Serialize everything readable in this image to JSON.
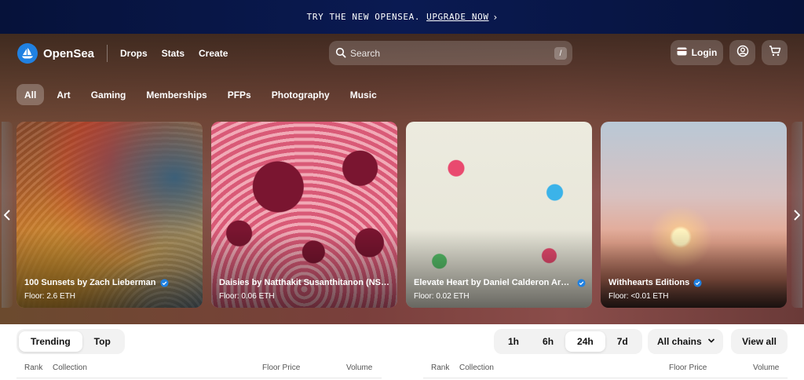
{
  "promo": {
    "text": "TRY THE NEW OPENSEA.",
    "link": "UPGRADE NOW"
  },
  "nav": {
    "brand": "OpenSea",
    "links": [
      "Drops",
      "Stats",
      "Create"
    ],
    "search_placeholder": "Search",
    "search_shortcut": "/",
    "login_label": "Login"
  },
  "categories": [
    {
      "label": "All",
      "active": true
    },
    {
      "label": "Art",
      "active": false
    },
    {
      "label": "Gaming",
      "active": false
    },
    {
      "label": "Memberships",
      "active": false
    },
    {
      "label": "PFPs",
      "active": false
    },
    {
      "label": "Photography",
      "active": false
    },
    {
      "label": "Music",
      "active": false
    }
  ],
  "cards": [
    {
      "name": "100 Sunsets by Zach Lieberman",
      "floor": "Floor: 2.6 ETH"
    },
    {
      "name": "Daisies by Natthakit Susanthitanon (NSmall)",
      "floor": "Floor: 0.06 ETH"
    },
    {
      "name": "Elevate Heart by Daniel Calderon Arenas",
      "floor": "Floor: 0.02 ETH"
    },
    {
      "name": "Withhearts Editions",
      "floor": "Floor: <0.01 ETH"
    }
  ],
  "list_tabs": [
    {
      "label": "Trending",
      "active": true
    },
    {
      "label": "Top",
      "active": false
    }
  ],
  "time_ranges": [
    {
      "label": "1h",
      "active": false
    },
    {
      "label": "6h",
      "active": false
    },
    {
      "label": "24h",
      "active": true
    },
    {
      "label": "7d",
      "active": false
    }
  ],
  "chain_select": "All chains",
  "view_all": "View all",
  "table_headers": {
    "rank": "Rank",
    "collection": "Collection",
    "floor": "Floor Price",
    "volume": "Volume"
  },
  "colors": {
    "brand_blue": "#2081e2",
    "verified_blue": "#2081e2",
    "promo_bg": "#06123a"
  }
}
